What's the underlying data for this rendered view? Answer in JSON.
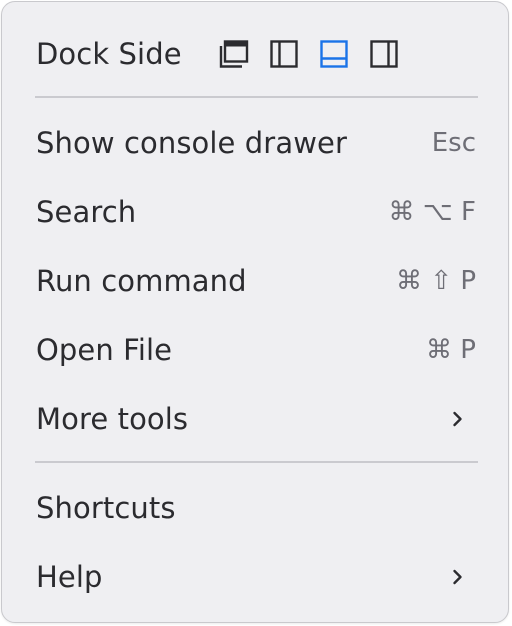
{
  "menu": {
    "dock_side": {
      "label": "Dock Side",
      "options": [
        {
          "name": "undock-icon",
          "selected": false
        },
        {
          "name": "dock-left-icon",
          "selected": false
        },
        {
          "name": "dock-bottom-icon",
          "selected": true
        },
        {
          "name": "dock-right-icon",
          "selected": false
        }
      ]
    },
    "items": [
      {
        "label": "Show console drawer",
        "shortcut": "Esc"
      },
      {
        "label": "Search",
        "shortcut": "⌘ ⌥ F"
      },
      {
        "label": "Run command",
        "shortcut": "⌘ ⇧ P"
      },
      {
        "label": "Open File",
        "shortcut": "⌘ P"
      },
      {
        "label": "More tools",
        "submenu_icon": "chevron-right-icon"
      }
    ],
    "footer_items": [
      {
        "label": "Shortcuts"
      },
      {
        "label": "Help",
        "submenu_icon": "chevron-right-icon"
      }
    ]
  },
  "colors": {
    "background": "#efeff2",
    "text": "#2b2b2f",
    "shortcut_text": "#6e6e76",
    "accent": "#1a73e8",
    "icon": "#2b2b2f"
  }
}
